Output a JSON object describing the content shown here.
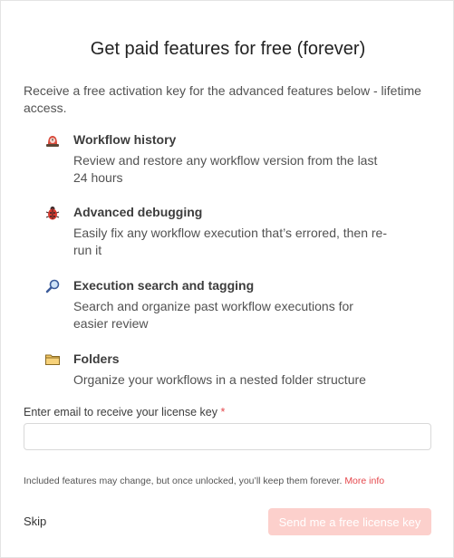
{
  "dialog": {
    "title": "Get paid features for free (forever)",
    "intro": "Receive a free activation key for the advanced features below - lifetime access."
  },
  "features": [
    {
      "icon": "history-icon",
      "title": "Workflow history",
      "description": "Review and restore any workflow version from the last 24 hours"
    },
    {
      "icon": "bug-icon",
      "title": "Advanced debugging",
      "description": "Easily fix any workflow execution that’s errored, then re-run it"
    },
    {
      "icon": "magnifier-icon",
      "title": "Execution search and tagging",
      "description": "Search and organize past workflow executions for easier review"
    },
    {
      "icon": "folder-icon",
      "title": "Folders",
      "description": "Organize your workflows in a nested folder structure"
    }
  ],
  "form": {
    "email_label": "Enter email to receive your license key",
    "required_marker": "*",
    "email_value": "",
    "email_placeholder": ""
  },
  "footer": {
    "note": "Included features may change, but once unlocked, you’ll keep them forever.",
    "more_info_label": "More info",
    "skip_label": "Skip",
    "send_label": "Send me a free license key"
  },
  "colors": {
    "accent": "#e5484d",
    "disabled_button": "#fcd0cc"
  }
}
